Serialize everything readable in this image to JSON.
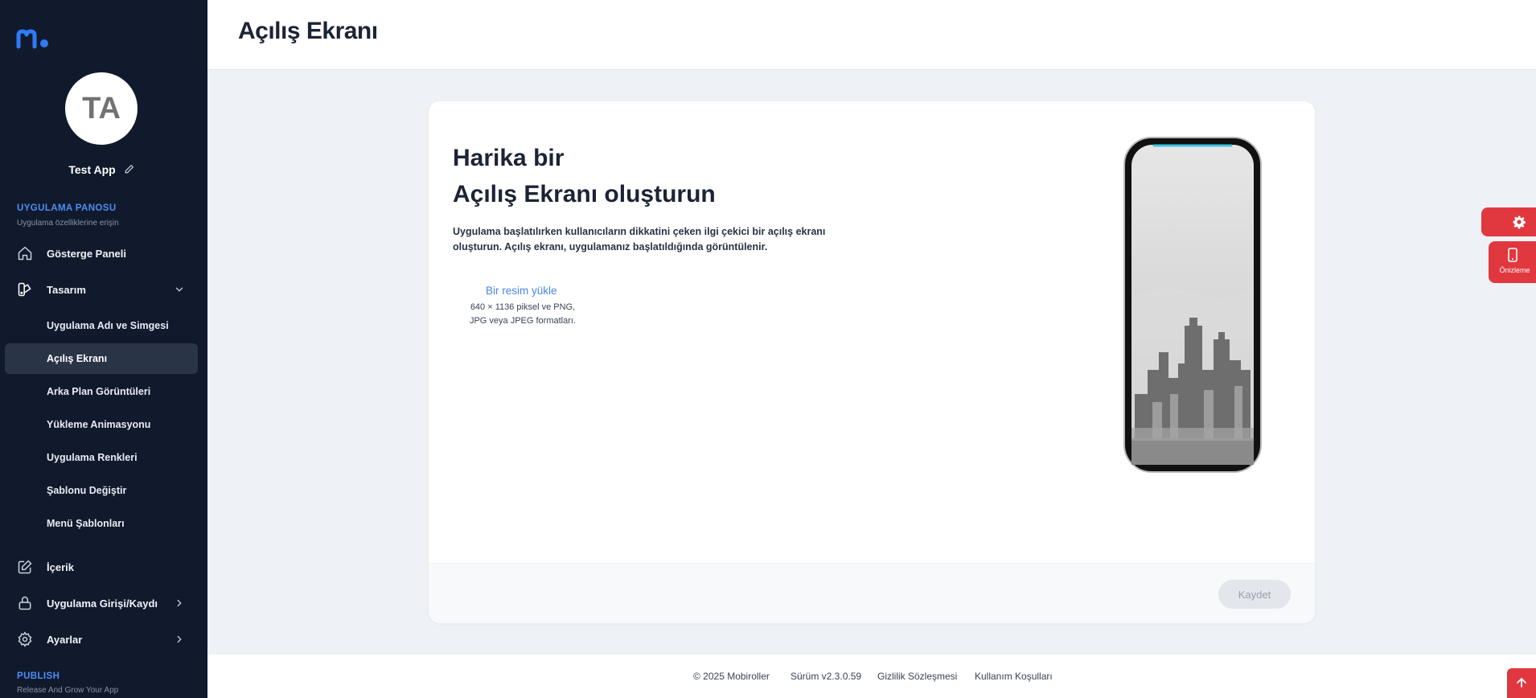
{
  "sidebar": {
    "avatar_initials": "TA",
    "app_name": "Test App",
    "section1": {
      "title": "UYGULAMA PANOSU",
      "subtitle": "Uygulama özelliklerine erişin"
    },
    "items": {
      "dashboard": "Gösterge Paneli",
      "design": "Tasarım",
      "content": "İçerik",
      "login": "Uygulama Girişi/Kaydı",
      "settings": "Ayarlar"
    },
    "design_sub": [
      "Uygulama Adı ve Simgesi",
      "Açılış Ekranı",
      "Arka Plan Görüntüleri",
      "Yükleme Animasyonu",
      "Uygulama Renkleri",
      "Şablonu Değiştir",
      "Menü Şablonları"
    ],
    "section2": {
      "title": "PUBLISH",
      "subtitle": "Release And Grow Your App"
    }
  },
  "header": {
    "title": "Açılış Ekranı"
  },
  "card": {
    "heading_line1": "Harika bir",
    "heading_line2": "Açılış Ekranı oluşturun",
    "description": "Uygulama başlatılırken kullanıcıların dikkatini çeken ilgi çekici bir açılış ekranı oluşturun. Açılış ekranı, uygulamanız başlatıldığında görüntülenir.",
    "upload_label": "Bir resim yükle",
    "upload_hint_line1": "640 × 1136 piksel ve PNG,",
    "upload_hint_line2": "JPG veya JPEG formatları.",
    "save_label": "Kaydet"
  },
  "floating": {
    "preview_label": "Önizleme"
  },
  "footer": {
    "copyright": "© 2025 Mobiroller",
    "version": "Sürüm v2.3.0.59",
    "privacy": "Gizlilik Sözleşmesi",
    "terms": "Kullanım Koşulları"
  },
  "colors": {
    "sidebar_bg": "#111a2c",
    "accent_blue": "#4c8df7",
    "accent_red": "#e0383e"
  }
}
